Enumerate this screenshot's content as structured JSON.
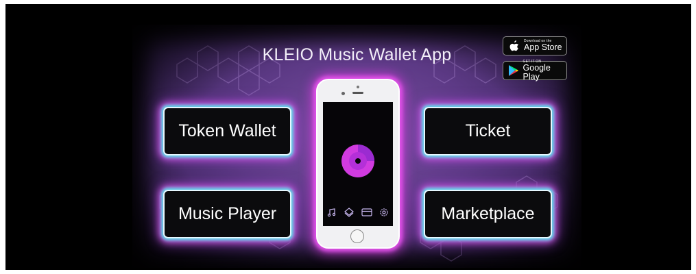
{
  "app": {
    "title": "KLEIO Music Wallet App"
  },
  "stores": {
    "apple": {
      "small": "Download on the",
      "big": "App Store"
    },
    "google": {
      "small": "GET IT ON",
      "big": "Google Play"
    }
  },
  "features": {
    "token_wallet": "Token Wallet",
    "ticket": "Ticket",
    "music_player": "Music Player",
    "marketplace": "Marketplace"
  },
  "phone": {
    "tabs": [
      "music-note-icon",
      "layers-icon",
      "card-icon",
      "gear-icon"
    ]
  },
  "colors": {
    "background": "#5d3a86",
    "glow_pink": "#e052e8",
    "glow_cyan": "#5fd7e8",
    "disc_magenta": "#d13be0"
  }
}
